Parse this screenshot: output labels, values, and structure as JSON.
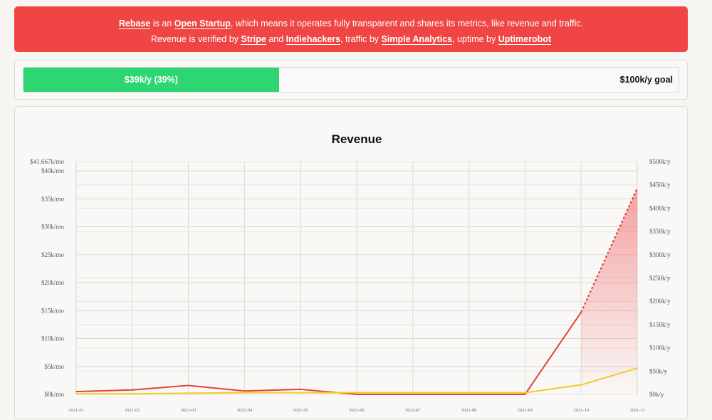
{
  "banner": {
    "line1": [
      {
        "text": "Rebase",
        "link": true
      },
      {
        "text": " is an ",
        "link": false
      },
      {
        "text": "Open Startup",
        "link": true
      },
      {
        "text": ", which means it operates fully transparent and shares its metrics, like revenue and traffic.",
        "link": false
      }
    ],
    "line2": [
      {
        "text": "Revenue is verified by ",
        "link": false
      },
      {
        "text": "Stripe",
        "link": true
      },
      {
        "text": " and ",
        "link": false
      },
      {
        "text": "Indiehackers",
        "link": true
      },
      {
        "text": ", traffic by ",
        "link": false
      },
      {
        "text": "Simple Analytics",
        "link": true
      },
      {
        "text": ", uptime by ",
        "link": false
      },
      {
        "text": "Uptimerobot",
        "link": true
      }
    ]
  },
  "progress": {
    "label": "$39k/y (39%)",
    "percent": 39,
    "goal_label": "$100k/y goal"
  },
  "chart_data": {
    "type": "line",
    "title": "Revenue",
    "x": [
      "2021-01",
      "2021-02",
      "2021-03",
      "2021-04",
      "2021-05",
      "2021-06",
      "2021-07",
      "2021-08",
      "2021-09",
      "2021-10",
      "2021-11"
    ],
    "left_axis": {
      "ticks": [
        "$0k/mo",
        "$5k/mo",
        "$10k/mo",
        "$15k/mo",
        "$20k/mo",
        "$25k/mo",
        "$30k/mo",
        "$35k/mo",
        "$40k/mo"
      ],
      "tick_values": [
        0,
        5,
        10,
        15,
        20,
        25,
        30,
        35,
        40
      ],
      "top_label": "$41.667k/mo",
      "ylim": [
        0,
        41.667
      ]
    },
    "right_axis": {
      "ticks": [
        "$0k/y",
        "$50k/y",
        "$100k/y",
        "$150k/y",
        "$200k/y",
        "$250k/y",
        "$300k/y",
        "$350k/y",
        "$400k/y",
        "$450k/y",
        "$500k/y"
      ],
      "tick_values": [
        0,
        50,
        100,
        150,
        200,
        250,
        300,
        350,
        400,
        450,
        500
      ],
      "ylim": [
        0,
        500
      ]
    },
    "grid": true,
    "series": [
      {
        "values": [
          0.5,
          0.8,
          1.6,
          0.6,
          0.9,
          0,
          0,
          0,
          0,
          14.7,
          null
        ],
        "projected": [
          null,
          null,
          null,
          null,
          null,
          null,
          null,
          null,
          null,
          14.7,
          36.9
        ],
        "color": "#e0433b",
        "fill": "#f25a5a"
      },
      {
        "values": [
          0.1,
          0.1,
          0.2,
          0.3,
          0.3,
          0.3,
          0.3,
          0.3,
          0.3,
          1.7,
          4.7
        ],
        "color": "#f2cc22"
      }
    ]
  }
}
